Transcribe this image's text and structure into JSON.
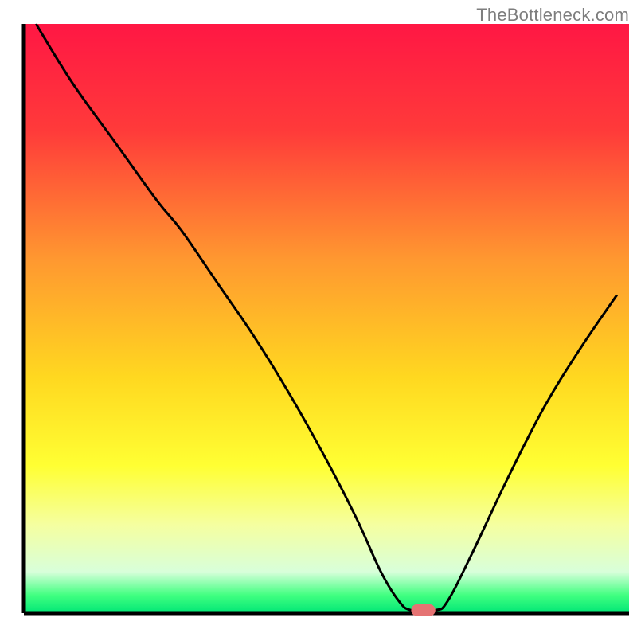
{
  "watermark": "TheBottleneck.com",
  "chart_data": {
    "type": "line",
    "title": "",
    "xlabel": "",
    "ylabel": "",
    "xlim": [
      0,
      100
    ],
    "ylim": [
      0,
      100
    ],
    "background_gradient": {
      "stops": [
        {
          "offset": 0.0,
          "color": "#ff1744"
        },
        {
          "offset": 0.18,
          "color": "#ff3a3a"
        },
        {
          "offset": 0.4,
          "color": "#ff9830"
        },
        {
          "offset": 0.6,
          "color": "#ffd820"
        },
        {
          "offset": 0.75,
          "color": "#ffff33"
        },
        {
          "offset": 0.85,
          "color": "#f5ffa0"
        },
        {
          "offset": 0.93,
          "color": "#d8ffda"
        },
        {
          "offset": 0.97,
          "color": "#40ff80"
        },
        {
          "offset": 1.0,
          "color": "#00e676"
        }
      ]
    },
    "curve": [
      {
        "x": 2,
        "y": 100
      },
      {
        "x": 8,
        "y": 90
      },
      {
        "x": 15,
        "y": 80
      },
      {
        "x": 22,
        "y": 70
      },
      {
        "x": 26,
        "y": 65
      },
      {
        "x": 32,
        "y": 56
      },
      {
        "x": 38,
        "y": 47
      },
      {
        "x": 44,
        "y": 37
      },
      {
        "x": 50,
        "y": 26
      },
      {
        "x": 55,
        "y": 16
      },
      {
        "x": 59,
        "y": 7
      },
      {
        "x": 62,
        "y": 2
      },
      {
        "x": 64,
        "y": 0.5
      },
      {
        "x": 68,
        "y": 0.5
      },
      {
        "x": 70,
        "y": 2
      },
      {
        "x": 74,
        "y": 10
      },
      {
        "x": 80,
        "y": 23
      },
      {
        "x": 86,
        "y": 35
      },
      {
        "x": 92,
        "y": 45
      },
      {
        "x": 98,
        "y": 54
      }
    ],
    "marker": {
      "x": 66,
      "y": 0.5,
      "color": "#e57373",
      "w": 4,
      "h": 2,
      "rx": 1
    }
  }
}
